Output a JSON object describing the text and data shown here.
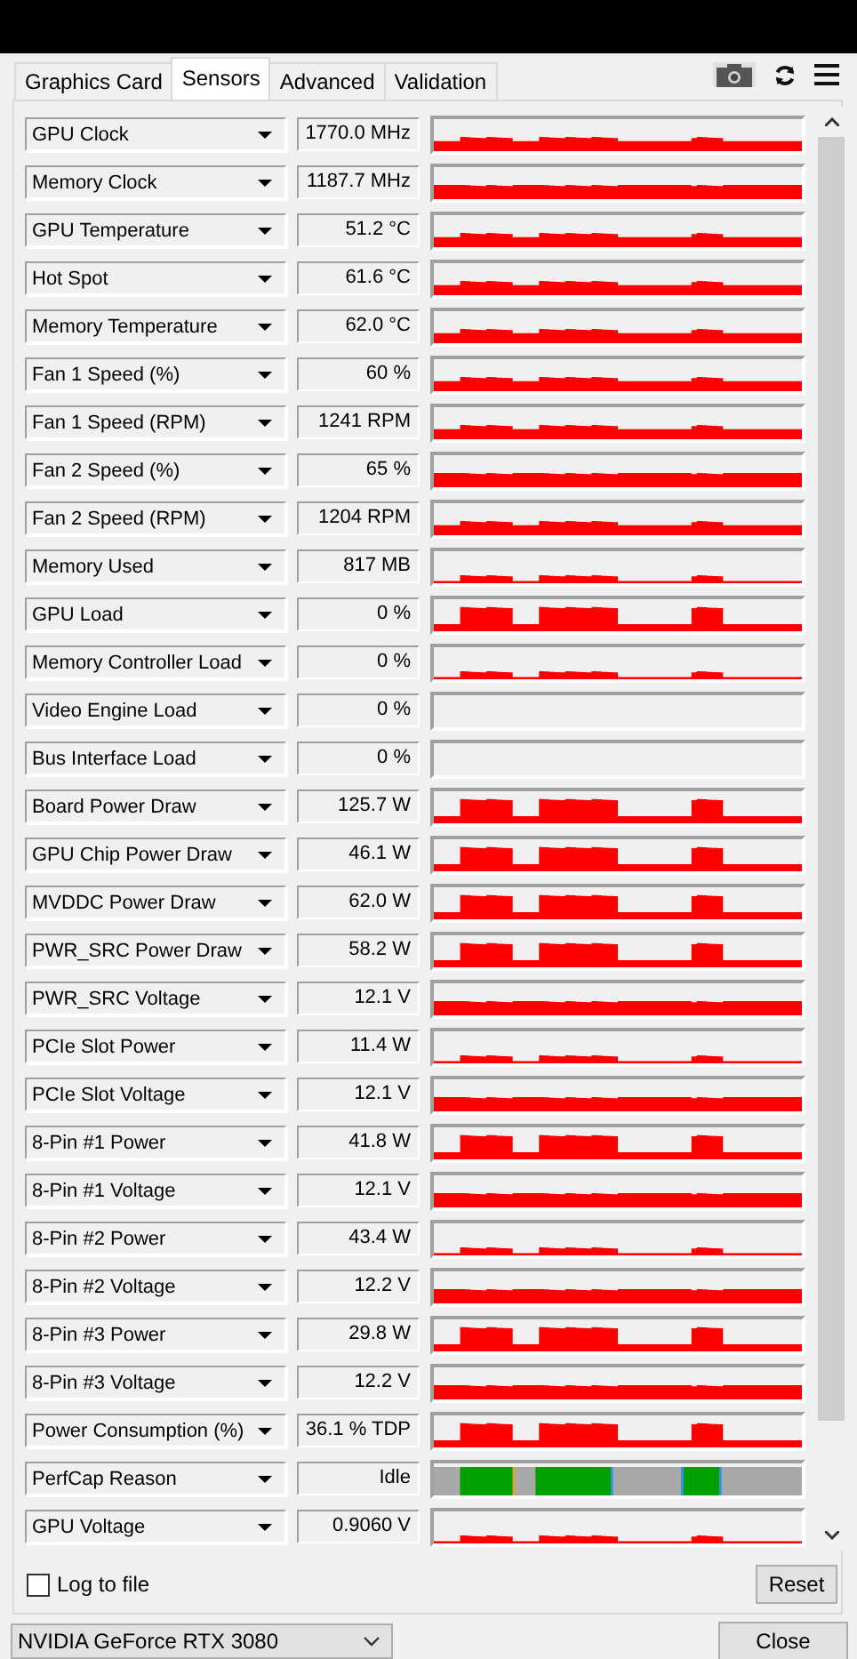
{
  "tabs": [
    {
      "label": "Graphics Card",
      "selected": false
    },
    {
      "label": "Sensors",
      "selected": true
    },
    {
      "label": "Advanced",
      "selected": false
    },
    {
      "label": "Validation",
      "selected": false
    }
  ],
  "sensors": [
    {
      "name": "GPU Clock",
      "value": "1770.0 MHz",
      "kind": "steady"
    },
    {
      "name": "Memory Clock",
      "value": "1187.7 MHz",
      "kind": "flat"
    },
    {
      "name": "GPU Temperature",
      "value": "51.2 °C",
      "kind": "steady"
    },
    {
      "name": "Hot Spot",
      "value": "61.6 °C",
      "kind": "steady"
    },
    {
      "name": "Memory Temperature",
      "value": "62.0 °C",
      "kind": "steady"
    },
    {
      "name": "Fan 1 Speed (%)",
      "value": "60 %",
      "kind": "steady"
    },
    {
      "name": "Fan 1 Speed (RPM)",
      "value": "1241 RPM",
      "kind": "steady"
    },
    {
      "name": "Fan 2 Speed (%)",
      "value": "65 %",
      "kind": "flat"
    },
    {
      "name": "Fan 2 Speed (RPM)",
      "value": "1204 RPM",
      "kind": "steady"
    },
    {
      "name": "Memory Used",
      "value": "817 MB",
      "kind": "low"
    },
    {
      "name": "GPU Load",
      "value": "0 %",
      "kind": "bursts"
    },
    {
      "name": "Memory Controller Load",
      "value": "0 %",
      "kind": "low"
    },
    {
      "name": "Video Engine Load",
      "value": "0 %",
      "kind": "empty"
    },
    {
      "name": "Bus Interface Load",
      "value": "0 %",
      "kind": "empty"
    },
    {
      "name": "Board Power Draw",
      "value": "125.7 W",
      "kind": "bursts"
    },
    {
      "name": "GPU Chip Power Draw",
      "value": "46.1 W",
      "kind": "bursts"
    },
    {
      "name": "MVDDC Power Draw",
      "value": "62.0 W",
      "kind": "bursts"
    },
    {
      "name": "PWR_SRC Power Draw",
      "value": "58.2 W",
      "kind": "bursts"
    },
    {
      "name": "PWR_SRC Voltage",
      "value": "12.1 V",
      "kind": "flat"
    },
    {
      "name": "PCIe Slot Power",
      "value": "11.4 W",
      "kind": "low"
    },
    {
      "name": "PCIe Slot Voltage",
      "value": "12.1 V",
      "kind": "flat"
    },
    {
      "name": "8-Pin #1 Power",
      "value": "41.8 W",
      "kind": "bursts"
    },
    {
      "name": "8-Pin #1 Voltage",
      "value": "12.1 V",
      "kind": "flat"
    },
    {
      "name": "8-Pin #2 Power",
      "value": "43.4 W",
      "kind": "low"
    },
    {
      "name": "8-Pin #2 Voltage",
      "value": "12.2 V",
      "kind": "flat"
    },
    {
      "name": "8-Pin #3 Power",
      "value": "29.8 W",
      "kind": "bursts"
    },
    {
      "name": "8-Pin #3 Voltage",
      "value": "12.2 V",
      "kind": "flat"
    },
    {
      "name": "Power Consumption (%)",
      "value": "36.1 % TDP",
      "kind": "bursts"
    },
    {
      "name": "PerfCap Reason",
      "value": "Idle",
      "kind": "perfcap"
    },
    {
      "name": "GPU Voltage",
      "value": "0.9060 V",
      "kind": "low"
    }
  ],
  "log_to_file": {
    "label": "Log to file",
    "checked": false
  },
  "reset_button": "Reset",
  "gpu_select": {
    "value": "NVIDIA GeForce RTX 3080"
  },
  "close_button": "Close"
}
